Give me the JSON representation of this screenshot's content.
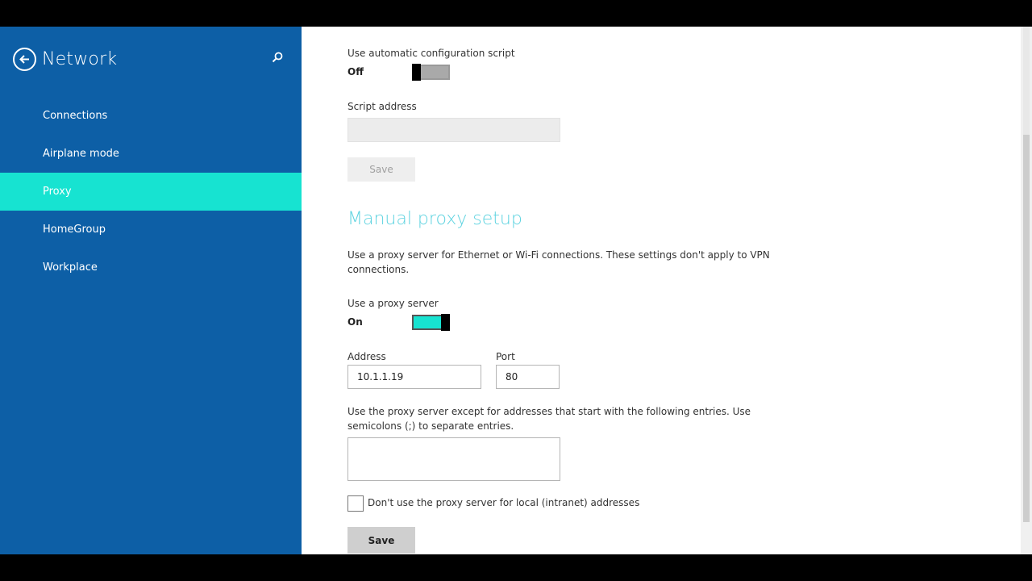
{
  "sidebar": {
    "title": "Network",
    "items": [
      {
        "label": "Connections"
      },
      {
        "label": "Airplane mode"
      },
      {
        "label": "Proxy"
      },
      {
        "label": "HomeGroup"
      },
      {
        "label": "Workplace"
      }
    ],
    "active_item": "Proxy"
  },
  "auto": {
    "script_label": "Use automatic configuration script",
    "script_state": "Off",
    "script_address_label": "Script address",
    "script_address_value": "",
    "save_label": "Save"
  },
  "manual": {
    "title": "Manual proxy setup",
    "description": "Use a proxy server for Ethernet or Wi-Fi connections. These settings don't apply to VPN connections.",
    "use_proxy_label": "Use a proxy server",
    "use_proxy_state": "On",
    "address_label": "Address",
    "address_value": "10.1.1.19",
    "port_label": "Port",
    "port_value": "80",
    "exceptions_label": "Use the proxy server except for addresses that start with the following entries. Use semicolons (;) to separate entries.",
    "exceptions_value": "",
    "local_checkbox_label": "Don't use the proxy server for local (intranet) addresses",
    "local_checkbox_checked": false,
    "save_label": "Save"
  },
  "colors": {
    "sidebar_bg": "#0d5fa6",
    "accent": "#17e3d1",
    "section_title": "#5ed3e0"
  }
}
